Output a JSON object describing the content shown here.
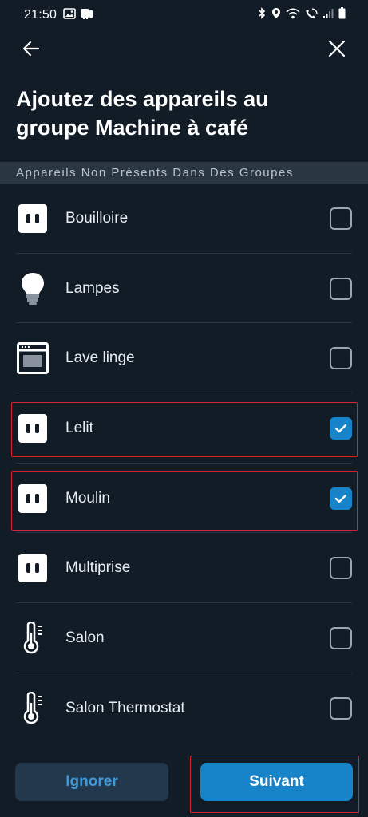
{
  "status_bar": {
    "time": "21:50",
    "left_icons": [
      "image-icon",
      "notification-icon"
    ],
    "right_icons": [
      "bluetooth-icon",
      "location-icon",
      "wifi-icon",
      "wifi-calling-icon",
      "signal-icon",
      "battery-icon"
    ]
  },
  "nav": {
    "back_icon": "arrow-left-icon",
    "close_icon": "close-icon"
  },
  "title": {
    "line1": "Ajoutez des appareils au",
    "line2": "groupe Machine à café"
  },
  "section_header": "Appareils Non Présents Dans Des Groupes",
  "devices": [
    {
      "label": "Bouilloire",
      "icon": "smart-plug-icon",
      "checked": false
    },
    {
      "label": "Lampes",
      "icon": "light-bulb-icon",
      "checked": false
    },
    {
      "label": "Lave linge",
      "icon": "washing-machine-icon",
      "checked": false
    },
    {
      "label": "Lelit",
      "icon": "smart-plug-icon",
      "checked": true
    },
    {
      "label": "Moulin",
      "icon": "smart-plug-icon",
      "checked": true
    },
    {
      "label": "Multiprise",
      "icon": "smart-plug-icon",
      "checked": false
    },
    {
      "label": "Salon",
      "icon": "thermometer-icon",
      "checked": false
    },
    {
      "label": "Salon Thermostat",
      "icon": "thermometer-icon",
      "checked": false
    }
  ],
  "footer": {
    "ignore_label": "Ignorer",
    "next_label": "Suivant"
  },
  "colors": {
    "background": "#121c27",
    "accent": "#1784c9",
    "highlight": "#d8232f"
  }
}
